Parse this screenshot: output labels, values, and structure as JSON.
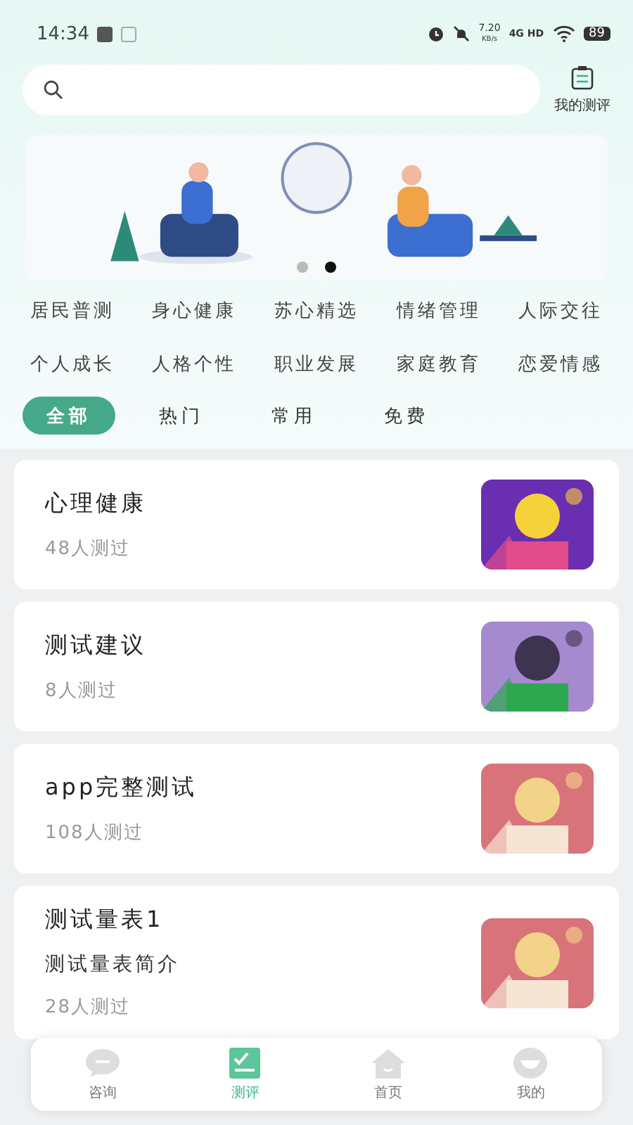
{
  "status_bar": {
    "time": "14:34",
    "net_speed": "7.20",
    "net_unit": "KB/s",
    "network": "4G HD",
    "battery": "89"
  },
  "my_tests": {
    "label": "我的测评"
  },
  "banner": {
    "dots": [
      {
        "selected": false
      },
      {
        "selected": true
      }
    ]
  },
  "categories": [
    "居民普测",
    "身心健康",
    "苏心精选",
    "情绪管理",
    "人际交往",
    "个人成长",
    "人格个性",
    "职业发展",
    "家庭教育",
    "恋爱情感"
  ],
  "filters": [
    {
      "label": "全部",
      "selected": true
    },
    {
      "label": "热门",
      "selected": false
    },
    {
      "label": "常用",
      "selected": false
    },
    {
      "label": "免费",
      "selected": false
    }
  ],
  "tests": [
    {
      "title": "心理健康",
      "count": "48人测过"
    },
    {
      "title": "测试建议",
      "count": "8人测过"
    },
    {
      "title": "app完整测试",
      "count": "108人测过"
    },
    {
      "title": "测试量表1",
      "subtitle": "测试量表简介",
      "count": "28人测过"
    }
  ],
  "nav": [
    {
      "label": "咨询",
      "selected": false
    },
    {
      "label": "测评",
      "selected": true
    },
    {
      "label": "首页",
      "selected": false
    },
    {
      "label": "我的",
      "selected": false
    }
  ]
}
